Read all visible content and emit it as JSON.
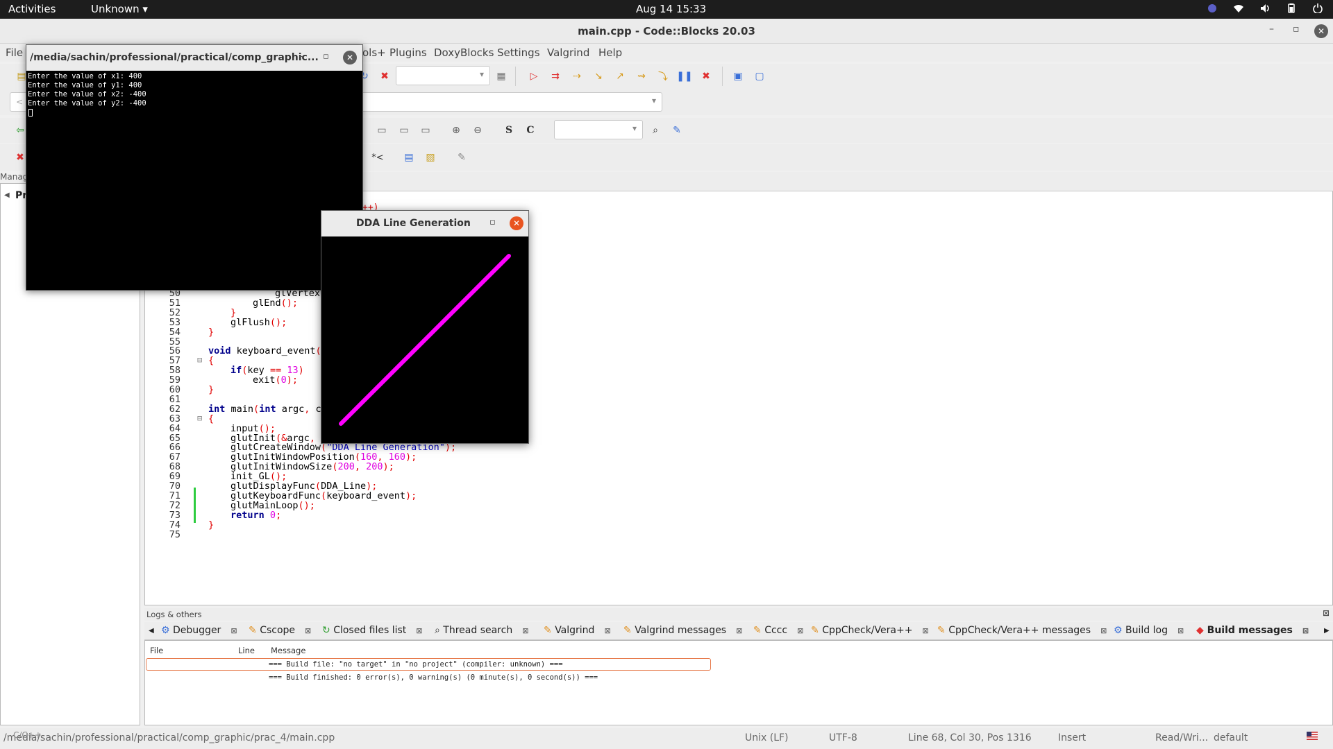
{
  "topbar": {
    "activities": "Activities",
    "app": "Unknown",
    "clock": "Aug 14  15:33"
  },
  "main_window": {
    "title": "main.cpp - Code::Blocks 20.03",
    "min": "–",
    "max": "▫",
    "close": "✕"
  },
  "menu": {
    "file": "File",
    "tools_plus": "ols+",
    "plugins": "Plugins",
    "doxyblocks": "DoxyBlocks",
    "settings": "Settings",
    "valgrind": "Valgrind",
    "help": "Help"
  },
  "toolbar": {
    "scope_combo_hint": "<",
    "s_button": "S",
    "c_button": "C",
    "tag_button": "*<"
  },
  "management": {
    "label": "Manag",
    "tab": "Pr"
  },
  "editor": {
    "lines": [
      {
        "n": "50",
        "code": "glVertex",
        "indent": 3
      },
      {
        "n": "51",
        "code": "glEnd();",
        "indent": 2
      },
      {
        "n": "52",
        "code": "}",
        "indent": 1
      },
      {
        "n": "53",
        "code": "glFlush();",
        "indent": 1
      },
      {
        "n": "54",
        "code": "}",
        "indent": 0
      },
      {
        "n": "55",
        "code": "",
        "indent": 0
      },
      {
        "n": "56",
        "code": "void keyboard_event(",
        "indent": 0
      },
      {
        "n": "57",
        "code": "{",
        "indent": 0
      },
      {
        "n": "58",
        "code": "if(key == 13)",
        "indent": 1
      },
      {
        "n": "59",
        "code": "exit(0);",
        "indent": 2
      },
      {
        "n": "60",
        "code": "}",
        "indent": 0
      },
      {
        "n": "61",
        "code": "",
        "indent": 0
      },
      {
        "n": "62",
        "code": "int main(int argc, c",
        "indent": 0
      },
      {
        "n": "63",
        "code": "{",
        "indent": 0
      },
      {
        "n": "64",
        "code": "input();",
        "indent": 1
      },
      {
        "n": "65",
        "code": "glutInit(&argc, argv);",
        "indent": 1
      },
      {
        "n": "66",
        "code": "glutCreateWindow(\"DDA Line Generation\");",
        "indent": 1
      },
      {
        "n": "67",
        "code": "glutInitWindowPosition(160, 160);",
        "indent": 1
      },
      {
        "n": "68",
        "code": "glutInitWindowSize(200, 200);",
        "indent": 1
      },
      {
        "n": "69",
        "code": "init_GL();",
        "indent": 1
      },
      {
        "n": "70",
        "code": "glutDisplayFunc(DDA_Line);",
        "indent": 1
      },
      {
        "n": "71",
        "code": "glutKeyboardFunc(keyboard_event);",
        "indent": 1
      },
      {
        "n": "72",
        "code": "glutMainLoop();",
        "indent": 1
      },
      {
        "n": "73",
        "code": "return 0;",
        "indent": 1
      },
      {
        "n": "74",
        "code": "}",
        "indent": 0
      },
      {
        "n": "75",
        "code": "",
        "indent": 0
      }
    ],
    "hidden_fragment": "++)"
  },
  "logs": {
    "header": "Logs & others",
    "tabs": [
      "Debugger",
      "Cscope",
      "Closed files list",
      "Thread search",
      "Valgrind",
      "Valgrind messages",
      "Cccc",
      "CppCheck/Vera++",
      "CppCheck/Vera++ messages",
      "Build log",
      "Build messages"
    ],
    "active_tab": "Build messages",
    "columns": {
      "file": "File",
      "line": "Line",
      "message": "Message"
    },
    "messages": [
      "=== Build file: \"no target\" in \"no project\" (compiler: unknown) ===",
      "=== Build finished: 0 error(s), 0 warning(s) (0 minute(s), 0 second(s)) ==="
    ]
  },
  "status": {
    "path": "/media/sachin/professional/practical/comp_graphic/prac_4/main.cpp",
    "overlay": "C/C++",
    "eol": "Unix (LF)",
    "encoding": "UTF-8",
    "position": "Line 68, Col 30, Pos 1316",
    "mode": "Insert",
    "access": "Read/Wri...",
    "profile": "default"
  },
  "terminal": {
    "title": "/media/sachin/professional/practical/comp_graphic...",
    "lines": [
      "Enter the value of x1: 400",
      "Enter the value of y1: 400",
      "Enter the value of x2: -400",
      "Enter the value of y2: -400"
    ]
  },
  "gl_window": {
    "title": "DDA Line Generation",
    "line_color": "#ff00ff",
    "line_from": [
      400,
      400
    ],
    "line_to": [
      -400,
      -400
    ]
  },
  "colors": {
    "topbar": "#1d1d1d",
    "close_active": "#e95420",
    "keyword": "#00008b",
    "number": "#e000e0",
    "string": "#0000c0"
  }
}
